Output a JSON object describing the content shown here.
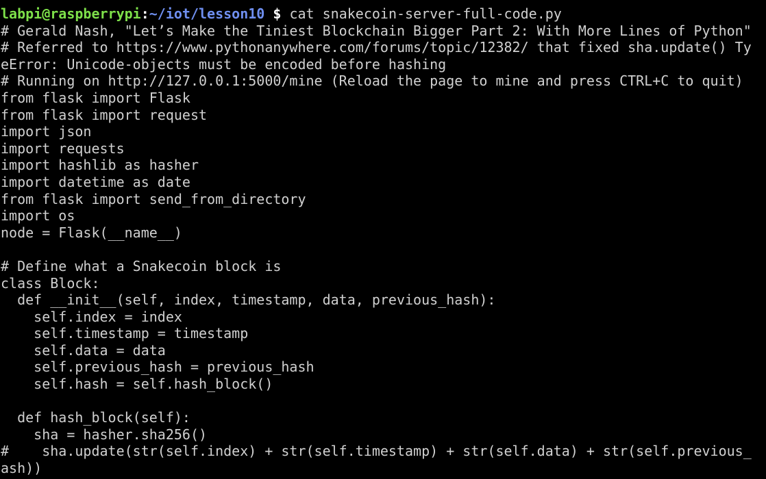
{
  "prompt": {
    "user_host": "labpi@raspberrypi",
    "separator": ":",
    "path": "~/iot/lesson10",
    "symbol": "$",
    "command": " cat snakecoin-server-full-code.py"
  },
  "colors": {
    "background": "#000000",
    "text": "#d0d0d0",
    "user_host": "#7ee04a",
    "path": "#6f8ff0"
  },
  "output_lines": [
    "# Gerald Nash, \"Let’s Make the Tiniest Blockchain Bigger Part 2: With More Lines of Python\"",
    "# Referred to https://www.pythonanywhere.com/forums/topic/12382/ that fixed sha.update() Ty",
    "eError: Unicode-objects must be encoded before hashing",
    "# Running on http://127.0.0.1:5000/mine (Reload the page to mine and press CTRL+C to quit)",
    "from flask import Flask",
    "from flask import request",
    "import json",
    "import requests",
    "import hashlib as hasher",
    "import datetime as date",
    "from flask import send_from_directory",
    "import os",
    "node = Flask(__name__)",
    "",
    "# Define what a Snakecoin block is",
    "class Block:",
    "  def __init__(self, index, timestamp, data, previous_hash):",
    "    self.index = index",
    "    self.timestamp = timestamp",
    "    self.data = data",
    "    self.previous_hash = previous_hash",
    "    self.hash = self.hash_block()",
    "",
    "  def hash_block(self):",
    "    sha = hasher.sha256()",
    "#    sha.update(str(self.index) + str(self.timestamp) + str(self.data) + str(self.previous_",
    "ash))"
  ]
}
